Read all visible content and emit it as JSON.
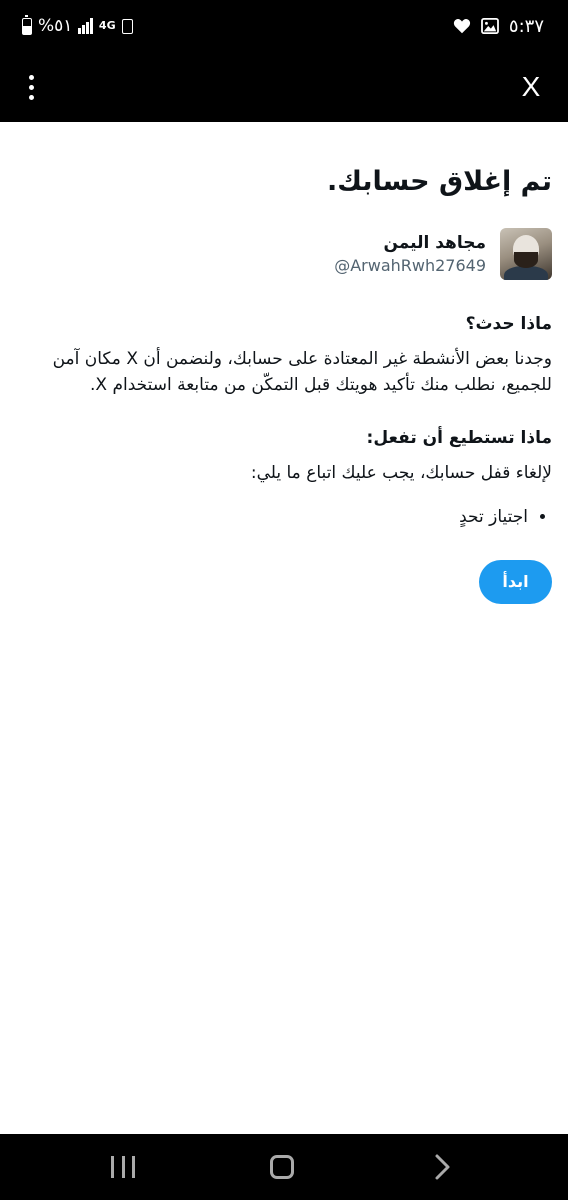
{
  "status_bar": {
    "battery_text": "%٥١",
    "network": "4G",
    "time": "٥:٣٧"
  },
  "icons": {
    "battery": "battery-icon",
    "signal": "signal-bars-icon",
    "network": "4g-network-icon",
    "sim": "sim-icon",
    "heart": "heart-icon",
    "gallery": "image-icon",
    "more": "more-vertical-icon",
    "close": "x-logo-icon",
    "nav_recent": "recent-apps-icon",
    "nav_home": "home-icon",
    "nav_back": "back-chevron-icon"
  },
  "app_bar": {
    "close_label": "X"
  },
  "content": {
    "title": "تم إغلاق حسابك.",
    "user": {
      "name": "مجاهد اليمن",
      "handle": "@ArwahRwh27649"
    },
    "what_happened_heading": "ماذا حدث؟",
    "what_happened_text": "وجدنا بعض الأنشطة غير المعتادة على حسابك، ولنضمن أن X مكان آمن للجميع، نطلب منك تأكيد هويتك قبل التمكّن من متابعة استخدام X.",
    "what_to_do_heading": "ماذا تستطيع أن تفعل:",
    "what_to_do_text": "لإلغاء قفل حسابك، يجب عليك اتباع ما يلي:",
    "steps": [
      "اجتياز تحدٍ"
    ],
    "start_button": "ابدأ"
  },
  "colors": {
    "accent": "#1d9bf0",
    "secondary_text": "#536471",
    "bar_background": "#000000"
  }
}
